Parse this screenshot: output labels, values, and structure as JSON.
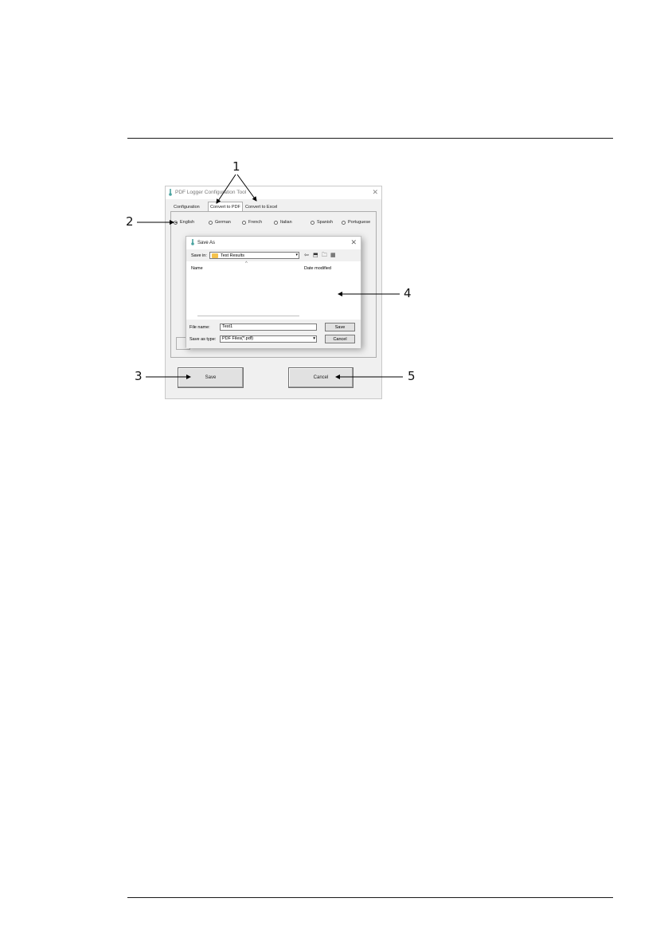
{
  "callouts": {
    "c1": "1",
    "c2": "2",
    "c3": "3",
    "c4": "4",
    "c5": "5"
  },
  "app": {
    "title": "PDF Logger Configuration Tool",
    "close": "✕",
    "tabs": [
      "Configuration",
      "Convert to PDF",
      "Convert to Excel"
    ],
    "languages": [
      {
        "label": "English",
        "selected": true
      },
      {
        "label": "German",
        "selected": false
      },
      {
        "label": "French",
        "selected": false
      },
      {
        "label": "Italian",
        "selected": false
      },
      {
        "label": "Spanish",
        "selected": false
      },
      {
        "label": "Portuguese",
        "selected": false
      }
    ],
    "save_button": "Save",
    "cancel_button": "Cancel"
  },
  "dialog": {
    "title": "Save As",
    "close": "✕",
    "save_in_label": "Save in:",
    "save_in_value": "Test Results",
    "column_name": "Name",
    "column_date": "Date modified",
    "file_name_label": "File name:",
    "file_name_value": "Test1",
    "save_as_type_label": "Save as type:",
    "save_as_type_value": "PDF Files(*.pdf)",
    "save_button": "Save",
    "cancel_button": "Cancel"
  },
  "colors": {
    "accent_folder": "#f4c24d",
    "window_bg": "#f0f0f0"
  }
}
